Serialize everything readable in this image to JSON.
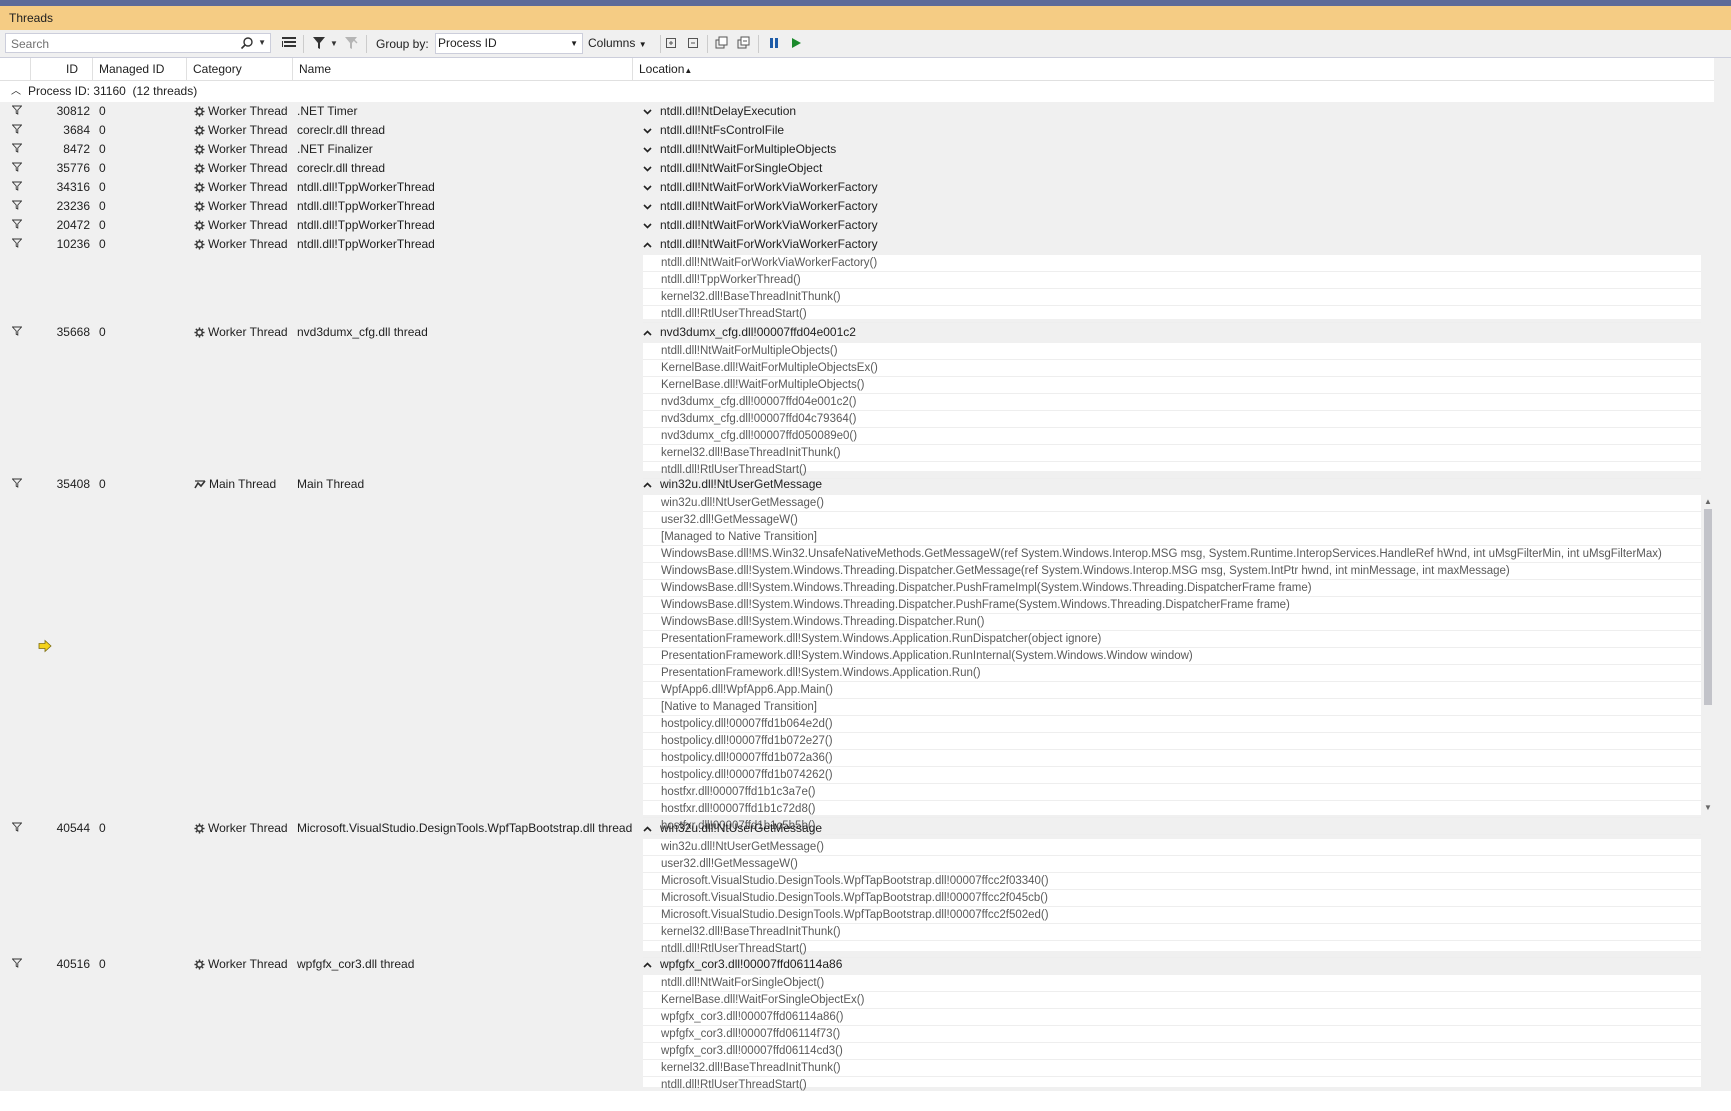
{
  "window": {
    "title": "Threads"
  },
  "toolbar": {
    "search_placeholder": "Search",
    "group_by_label": "Group by:",
    "group_by_value": "Process ID",
    "columns_label": "Columns"
  },
  "columns": {
    "id": "ID",
    "managed_id": "Managed ID",
    "category": "Category",
    "name": "Name",
    "location": "Location"
  },
  "group": {
    "label": "Process ID: 31160",
    "count": "(12 threads)"
  },
  "threads": [
    {
      "id": "30812",
      "managed_id": "0",
      "category": "Worker Thread",
      "name": ".NET Timer",
      "location": "ntdll.dll!NtDelayExecution",
      "expanded": false,
      "frames": []
    },
    {
      "id": "3684",
      "managed_id": "0",
      "category": "Worker Thread",
      "name": "coreclr.dll thread",
      "location": "ntdll.dll!NtFsControlFile",
      "expanded": false,
      "frames": []
    },
    {
      "id": "8472",
      "managed_id": "0",
      "category": "Worker Thread",
      "name": ".NET Finalizer",
      "location": "ntdll.dll!NtWaitForMultipleObjects",
      "expanded": false,
      "frames": []
    },
    {
      "id": "35776",
      "managed_id": "0",
      "category": "Worker Thread",
      "name": "coreclr.dll thread",
      "location": "ntdll.dll!NtWaitForSingleObject",
      "expanded": false,
      "frames": []
    },
    {
      "id": "34316",
      "managed_id": "0",
      "category": "Worker Thread",
      "name": "ntdll.dll!TppWorkerThread",
      "location": "ntdll.dll!NtWaitForWorkViaWorkerFactory",
      "expanded": false,
      "frames": []
    },
    {
      "id": "23236",
      "managed_id": "0",
      "category": "Worker Thread",
      "name": "ntdll.dll!TppWorkerThread",
      "location": "ntdll.dll!NtWaitForWorkViaWorkerFactory",
      "expanded": false,
      "frames": []
    },
    {
      "id": "20472",
      "managed_id": "0",
      "category": "Worker Thread",
      "name": "ntdll.dll!TppWorkerThread",
      "location": "ntdll.dll!NtWaitForWorkViaWorkerFactory",
      "expanded": false,
      "frames": []
    },
    {
      "id": "10236",
      "managed_id": "0",
      "category": "Worker Thread",
      "name": "ntdll.dll!TppWorkerThread",
      "location": "ntdll.dll!NtWaitForWorkViaWorkerFactory",
      "expanded": true,
      "frames": [
        "ntdll.dll!NtWaitForWorkViaWorkerFactory()",
        "ntdll.dll!TppWorkerThread()",
        "kernel32.dll!BaseThreadInitThunk()",
        "ntdll.dll!RtlUserThreadStart()"
      ]
    },
    {
      "id": "35668",
      "managed_id": "0",
      "category": "Worker Thread",
      "name": "nvd3dumx_cfg.dll thread",
      "location": "nvd3dumx_cfg.dll!00007ffd04e001c2",
      "expanded": true,
      "frames": [
        "ntdll.dll!NtWaitForMultipleObjects()",
        "KernelBase.dll!WaitForMultipleObjectsEx()",
        "KernelBase.dll!WaitForMultipleObjects()",
        "nvd3dumx_cfg.dll!00007ffd04e001c2()",
        "nvd3dumx_cfg.dll!00007ffd04c79364()",
        "nvd3dumx_cfg.dll!00007ffd050089e0()",
        "kernel32.dll!BaseThreadInitThunk()",
        "ntdll.dll!RtlUserThreadStart()"
      ]
    },
    {
      "id": "35408",
      "managed_id": "0",
      "category": "Main Thread",
      "name": "Main Thread",
      "location": "win32u.dll!NtUserGetMessage",
      "expanded": true,
      "main": true,
      "frames": [
        "win32u.dll!NtUserGetMessage()",
        "user32.dll!GetMessageW()",
        "[Managed to Native Transition]",
        "WindowsBase.dll!MS.Win32.UnsafeNativeMethods.GetMessageW(ref System.Windows.Interop.MSG msg, System.Runtime.InteropServices.HandleRef hWnd, int uMsgFilterMin, int uMsgFilterMax)",
        "WindowsBase.dll!System.Windows.Threading.Dispatcher.GetMessage(ref System.Windows.Interop.MSG msg, System.IntPtr hwnd, int minMessage, int maxMessage)",
        "WindowsBase.dll!System.Windows.Threading.Dispatcher.PushFrameImpl(System.Windows.Threading.DispatcherFrame frame)",
        "WindowsBase.dll!System.Windows.Threading.Dispatcher.PushFrame(System.Windows.Threading.DispatcherFrame frame)",
        "WindowsBase.dll!System.Windows.Threading.Dispatcher.Run()",
        "PresentationFramework.dll!System.Windows.Application.RunDispatcher(object ignore)",
        "PresentationFramework.dll!System.Windows.Application.RunInternal(System.Windows.Window window)",
        "PresentationFramework.dll!System.Windows.Application.Run()",
        "WpfApp6.dll!WpfApp6.App.Main()",
        "[Native to Managed Transition]",
        "hostpolicy.dll!00007ffd1b064e2d()",
        "hostpolicy.dll!00007ffd1b072e27()",
        "hostpolicy.dll!00007ffd1b072a36()",
        "hostpolicy.dll!00007ffd1b074262()",
        "hostfxr.dll!00007ffd1b1c3a7e()",
        "hostfxr.dll!00007ffd1b1c72d8()",
        "hostfxr.dll!00007ffd1b1c5b5b()"
      ]
    },
    {
      "id": "40544",
      "managed_id": "0",
      "category": "Worker Thread",
      "name": "Microsoft.VisualStudio.DesignTools.WpfTapBootstrap.dll thread",
      "location": "win32u.dll!NtUserGetMessage",
      "expanded": true,
      "frames": [
        "win32u.dll!NtUserGetMessage()",
        "user32.dll!GetMessageW()",
        "Microsoft.VisualStudio.DesignTools.WpfTapBootstrap.dll!00007ffcc2f03340()",
        "Microsoft.VisualStudio.DesignTools.WpfTapBootstrap.dll!00007ffcc2f045cb()",
        "Microsoft.VisualStudio.DesignTools.WpfTapBootstrap.dll!00007ffcc2f502ed()",
        "kernel32.dll!BaseThreadInitThunk()",
        "ntdll.dll!RtlUserThreadStart()"
      ]
    },
    {
      "id": "40516",
      "managed_id": "0",
      "category": "Worker Thread",
      "name": "wpfgfx_cor3.dll thread",
      "location": "wpfgfx_cor3.dll!00007ffd06114a86",
      "expanded": true,
      "frames": [
        "ntdll.dll!NtWaitForSingleObject()",
        "KernelBase.dll!WaitForSingleObjectEx()",
        "wpfgfx_cor3.dll!00007ffd06114a86()",
        "wpfgfx_cor3.dll!00007ffd06114f73()",
        "wpfgfx_cor3.dll!00007ffd06114cd3()",
        "kernel32.dll!BaseThreadInitThunk()",
        "ntdll.dll!RtlUserThreadStart()"
      ]
    }
  ]
}
